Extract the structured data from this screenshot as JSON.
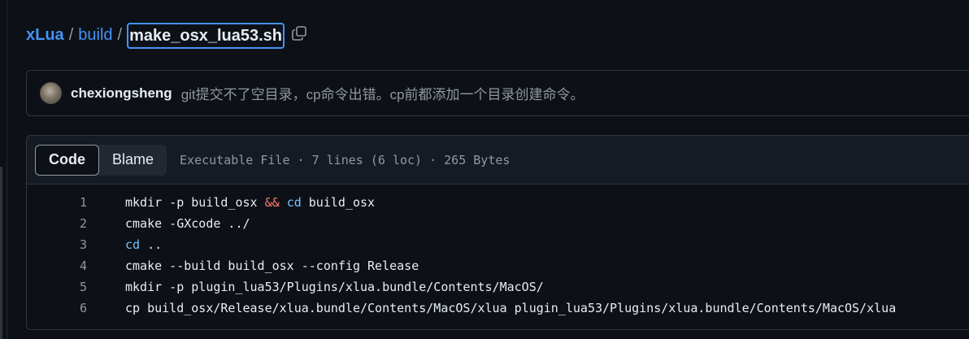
{
  "breadcrumb": {
    "repo": "xLua",
    "folder": "build",
    "separator": "/",
    "file": "make_osx_lua53.sh",
    "copy_icon": "copy-icon"
  },
  "commit": {
    "author": "chexiongsheng",
    "message": "git提交不了空目录，cp命令出错。cp前都添加一个目录创建命令。"
  },
  "file_header": {
    "tabs": [
      "Code",
      "Blame"
    ],
    "active_tab": "Code",
    "info": "Executable File · 7 lines (6 loc) · 265 Bytes"
  },
  "code": {
    "lines": [
      {
        "number": "1",
        "tokens": [
          {
            "t": "mkdir -p build_osx "
          },
          {
            "t": "&&",
            "c": "op"
          },
          {
            "t": " "
          },
          {
            "t": "cd",
            "c": "builtin"
          },
          {
            "t": " build_osx"
          }
        ]
      },
      {
        "number": "2",
        "tokens": [
          {
            "t": "cmake -GXcode ../"
          }
        ]
      },
      {
        "number": "3",
        "tokens": [
          {
            "t": "cd",
            "c": "builtin"
          },
          {
            "t": " .."
          }
        ]
      },
      {
        "number": "4",
        "tokens": [
          {
            "t": "cmake --build build_osx --config Release"
          }
        ]
      },
      {
        "number": "5",
        "tokens": [
          {
            "t": "mkdir -p plugin_lua53/Plugins/xlua.bundle/Contents/MacOS/"
          }
        ]
      },
      {
        "number": "6",
        "tokens": [
          {
            "t": "cp build_osx/Release/xlua.bundle/Contents/MacOS/xlua plugin_lua53/Plugins/xlua.bundle/Contents/MacOS/xlua"
          }
        ]
      }
    ]
  },
  "colors": {
    "background": "#0d1117",
    "link": "#4493f8",
    "muted": "#9198a1",
    "operator": "#ff7b72",
    "builtin": "#79c0ff"
  }
}
